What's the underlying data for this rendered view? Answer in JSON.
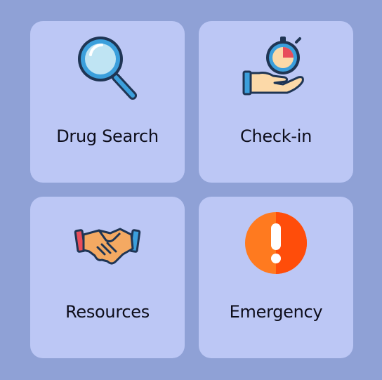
{
  "tiles": [
    {
      "label": "Drug Search",
      "icon": "magnifying-glass-icon"
    },
    {
      "label": "Check-in",
      "icon": "stopwatch-hand-icon"
    },
    {
      "label": "Resources",
      "icon": "handshake-icon"
    },
    {
      "label": "Emergency",
      "icon": "exclamation-alert-icon"
    }
  ],
  "colors": {
    "background": "#8fa1d6",
    "tile": "#bcc7f5",
    "text": "#0d0d1a",
    "emergency": "#ff5a0a"
  }
}
